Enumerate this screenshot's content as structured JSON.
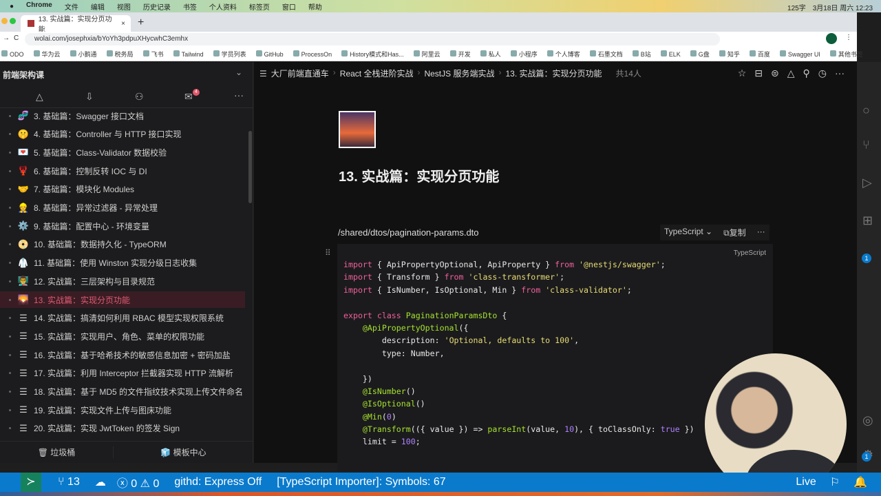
{
  "menubar": {
    "items": [
      "Chrome",
      "文件",
      "编辑",
      "视图",
      "历史记录",
      "书签",
      "个人资料",
      "标签页",
      "窗口",
      "帮助"
    ],
    "word_count": "125字",
    "datetime": "3月18日 周六 12:23"
  },
  "browser": {
    "tab_title": "13. 实战篇：实现分页功能",
    "url": "wolai.com/josephxia/bYoYh3pdpuXHycwhC3emhx",
    "bookmarks": [
      "ODO",
      "华为云",
      "小鹅通",
      "税务局",
      "飞书",
      "Tailwind",
      "学员列表",
      "GitHub",
      "ProcessOn",
      "History模式和Has...",
      "阿里云",
      "开发",
      "私人",
      "小程序",
      "个人博客",
      "石墨文档",
      "B站",
      "ELK",
      "G盘",
      "知乎",
      "百度",
      "Swagger UI",
      "其他书签"
    ]
  },
  "sidebar": {
    "title": "前端架构课",
    "badge": "4",
    "items": [
      {
        "icon": "🧬",
        "label": "3. 基础篇：Swagger 接口文档"
      },
      {
        "icon": "🤫",
        "label": "4. 基础篇：Controller 与 HTTP 接口实现"
      },
      {
        "icon": "💌",
        "label": "5. 基础篇：Class-Validator 数据校验"
      },
      {
        "icon": "🦞",
        "label": "6. 基础篇：控制反转 IOC 与 DI"
      },
      {
        "icon": "🤝",
        "label": "7. 基础篇：模块化 Modules"
      },
      {
        "icon": "👷",
        "label": "8. 基础篇：异常过滤器 - 异常处理"
      },
      {
        "icon": "⚙️",
        "label": "9. 基础篇：配置中心 - 环境变量"
      },
      {
        "icon": "📀",
        "label": "10. 基础篇：数据持久化 - TypeORM"
      },
      {
        "icon": "🥼",
        "label": "11. 基础篇：使用 Winston 实现分级日志收集"
      },
      {
        "icon": "👨‍🏫",
        "label": "12. 实战篇：三层架构与目录规范"
      },
      {
        "icon": "🌄",
        "label": "13. 实战篇：实现分页功能",
        "active": true
      },
      {
        "icon": "☰",
        "label": "14. 实战篇：搞清如何利用 RBAC 模型实现权限系统"
      },
      {
        "icon": "☰",
        "label": "15. 实战篇：实现用户、角色、菜单的权限功能"
      },
      {
        "icon": "☰",
        "label": "16. 实战篇：基于哈希技术的敏感信息加密 + 密码加盐"
      },
      {
        "icon": "☰",
        "label": "17. 实战篇：利用 Interceptor 拦截器实现 HTTP 流解析"
      },
      {
        "icon": "☰",
        "label": "18. 实战篇：基于 MD5 的文件指纹技术实现上传文件命名"
      },
      {
        "icon": "☰",
        "label": "19. 实战篇：实现文件上传与图床功能"
      },
      {
        "icon": "☰",
        "label": "20. 实战篇：实现 JwtToken 的签发 Sign"
      }
    ],
    "trash": "垃圾桶",
    "templates": "模板中心"
  },
  "breadcrumb": [
    "大厂前端直通车",
    "React 全栈进阶实战",
    "NestJS 服务端实战",
    "13. 实战篇：实现分页功能"
  ],
  "members": "共14人",
  "page": {
    "title": "13. 实战篇：实现分页功能",
    "code_caption": "/shared/dtos/pagination-params.dto",
    "lang_select": "TypeScript",
    "copy": "复制",
    "lang_label": "TypeScript",
    "code": [
      [
        [
          "import",
          "kw"
        ],
        [
          " { ApiPropertyOptional, ApiProperty } ",
          "pl"
        ],
        [
          "from",
          "kw"
        ],
        [
          " ",
          "pl"
        ],
        [
          "'@nestjs/swagger'",
          "str"
        ],
        [
          ";",
          "pl"
        ]
      ],
      [
        [
          "import",
          "kw"
        ],
        [
          " { Transform } ",
          "pl"
        ],
        [
          "from",
          "kw"
        ],
        [
          " ",
          "pl"
        ],
        [
          "'class-transformer'",
          "str"
        ],
        [
          ";",
          "pl"
        ]
      ],
      [
        [
          "import",
          "kw"
        ],
        [
          " { IsNumber, IsOptional, Min } ",
          "pl"
        ],
        [
          "from",
          "kw"
        ],
        [
          " ",
          "pl"
        ],
        [
          "'class-validator'",
          "str"
        ],
        [
          ";",
          "pl"
        ]
      ],
      [],
      [
        [
          "export class",
          "kw"
        ],
        [
          " ",
          "pl"
        ],
        [
          "PaginationParamsDto",
          "fn"
        ],
        [
          " {",
          "pl"
        ]
      ],
      [
        [
          "    ",
          "pl"
        ],
        [
          "@ApiPropertyOptional",
          "fn"
        ],
        [
          "({",
          "pl"
        ]
      ],
      [
        [
          "        description: ",
          "pl"
        ],
        [
          "'Optional, defaults to 100'",
          "str"
        ],
        [
          ",",
          "pl"
        ]
      ],
      [
        [
          "        type: Number,",
          "pl"
        ]
      ],
      [],
      [
        [
          "    })",
          "pl"
        ]
      ],
      [
        [
          "    ",
          "pl"
        ],
        [
          "@IsNumber",
          "fn"
        ],
        [
          "()",
          "pl"
        ]
      ],
      [
        [
          "    ",
          "pl"
        ],
        [
          "@IsOptional",
          "fn"
        ],
        [
          "()",
          "pl"
        ]
      ],
      [
        [
          "    ",
          "pl"
        ],
        [
          "@Min",
          "fn"
        ],
        [
          "(",
          "pl"
        ],
        [
          "0",
          "num"
        ],
        [
          ")",
          "pl"
        ]
      ],
      [
        [
          "    ",
          "pl"
        ],
        [
          "@Transform",
          "fn"
        ],
        [
          "(({ value }) => ",
          "pl"
        ],
        [
          "parseInt",
          "fn"
        ],
        [
          "(value, ",
          "pl"
        ],
        [
          "10",
          "num"
        ],
        [
          "), { toClassOnly: ",
          "pl"
        ],
        [
          "true",
          "num"
        ],
        [
          " })",
          "pl"
        ]
      ],
      [
        [
          "    limit = ",
          "pl"
        ],
        [
          "100",
          "num"
        ],
        [
          ";",
          "pl"
        ]
      ]
    ]
  },
  "status": {
    "branch": "13",
    "errors": "0",
    "warnings": "0",
    "githd": "githd: Express Off",
    "importer": "[TypeScript Importer]: Symbols: 67",
    "live": "Live",
    "vsc_badge1": "1",
    "vsc_badge2": "1"
  }
}
